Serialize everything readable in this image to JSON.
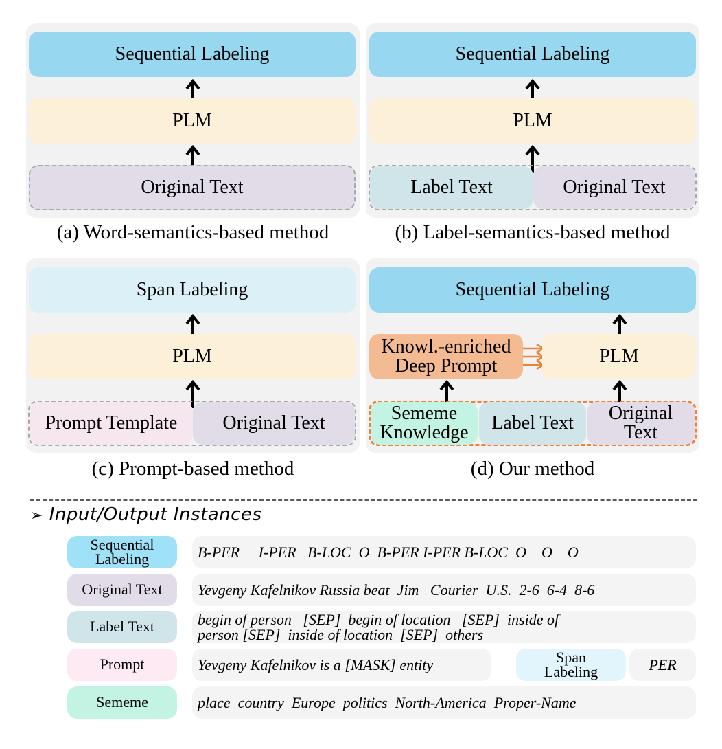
{
  "panels": {
    "a": {
      "caption": "(a) Word-semantics-based method",
      "output": "Sequential Labeling",
      "model": "PLM",
      "input": "Original Text"
    },
    "b": {
      "caption": "(b) Label-semantics-based method",
      "output": "Sequential Labeling",
      "model": "PLM",
      "input_left": "Label Text",
      "input_right": "Original Text"
    },
    "c": {
      "caption": "(c) Prompt-based method",
      "output": "Span Labeling",
      "model": "PLM",
      "input_left": "Prompt Template",
      "input_right": "Original Text"
    },
    "d": {
      "caption": "(d) Our method",
      "output": "Sequential Labeling",
      "model": "PLM",
      "prompt_line1": "Knowl.-enriched",
      "prompt_line2": "Deep Prompt",
      "input_sememe_line1": "Sememe",
      "input_sememe_line2": "Knowledge",
      "input_label": "Label Text",
      "input_orig_line1": "Original",
      "input_orig_line2": "Text"
    }
  },
  "io": {
    "bullet": "➢",
    "title": "Input/Output Instances",
    "rows": [
      {
        "label_line1": "Sequential",
        "label_line2": "Labeling",
        "content": "B-PER     I-PER   B-LOC  O  B-PER I-PER B-LOC  O    O    O"
      },
      {
        "label_line1": "Original Text",
        "label_line2": "",
        "content": "Yevgeny Kafelnikov Russia beat  Jim   Courier  U.S.  2-6  6-4  8-6"
      },
      {
        "label_line1": "Label Text",
        "label_line2": "",
        "content_line1": "begin of person   [SEP]  begin of location   [SEP]  inside of",
        "content_line2": "person [SEP]  inside of location  [SEP]  others"
      },
      {
        "label_line1": "Prompt",
        "label_line2": "",
        "content": "Yevgeny Kafelnikov is a [MASK] entity",
        "span_label_line1": "Span",
        "span_label_line2": "Labeling",
        "span_value": "PER"
      },
      {
        "label_line1": "Sememe",
        "label_line2": "",
        "content": "place  country  Europe  politics  North-America  Proper-Name"
      }
    ]
  },
  "colors": {
    "sequential_labeling": "#97d8f0",
    "span_labeling": "#dcf0f8",
    "plm": "#fcf0d8",
    "original_text": "#e2dce8",
    "label_text": "#cfe5ea",
    "prompt": "#f6e6ee",
    "sememe": "#c3f4e3",
    "deep_prompt": "#f4bb92",
    "accent_orange": "#ee8236"
  }
}
